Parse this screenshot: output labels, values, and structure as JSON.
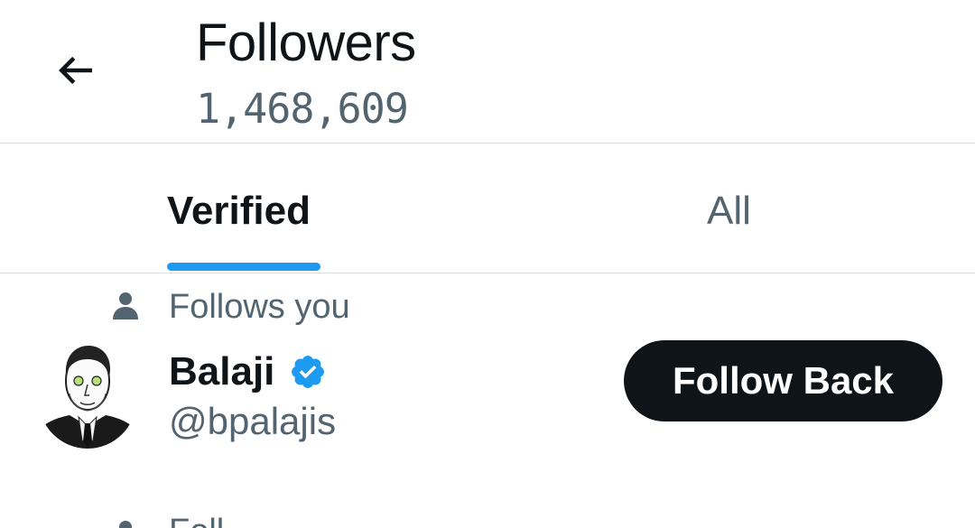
{
  "header": {
    "back_icon": "arrow-left-icon",
    "title": "Followers",
    "count": "1,468,609"
  },
  "tabs": [
    {
      "label": "Verified",
      "selected": true
    },
    {
      "label": "All",
      "selected": false
    }
  ],
  "colors": {
    "accent": "#1d9bf0",
    "text_primary": "#0f1419",
    "text_secondary": "#536471",
    "button_bg": "#0f1419",
    "divider": "#dadfe3"
  },
  "followers": [
    {
      "follows_you_label": "Follows you",
      "follows_you_icon": "person-icon",
      "name": "Balaji",
      "verified_icon": "verified-badge-icon",
      "handle": "@bpalajis",
      "avatar_icon": "avatar-sketch",
      "action_label": "Follow Back"
    }
  ],
  "next_row_partial_text": "Foll"
}
